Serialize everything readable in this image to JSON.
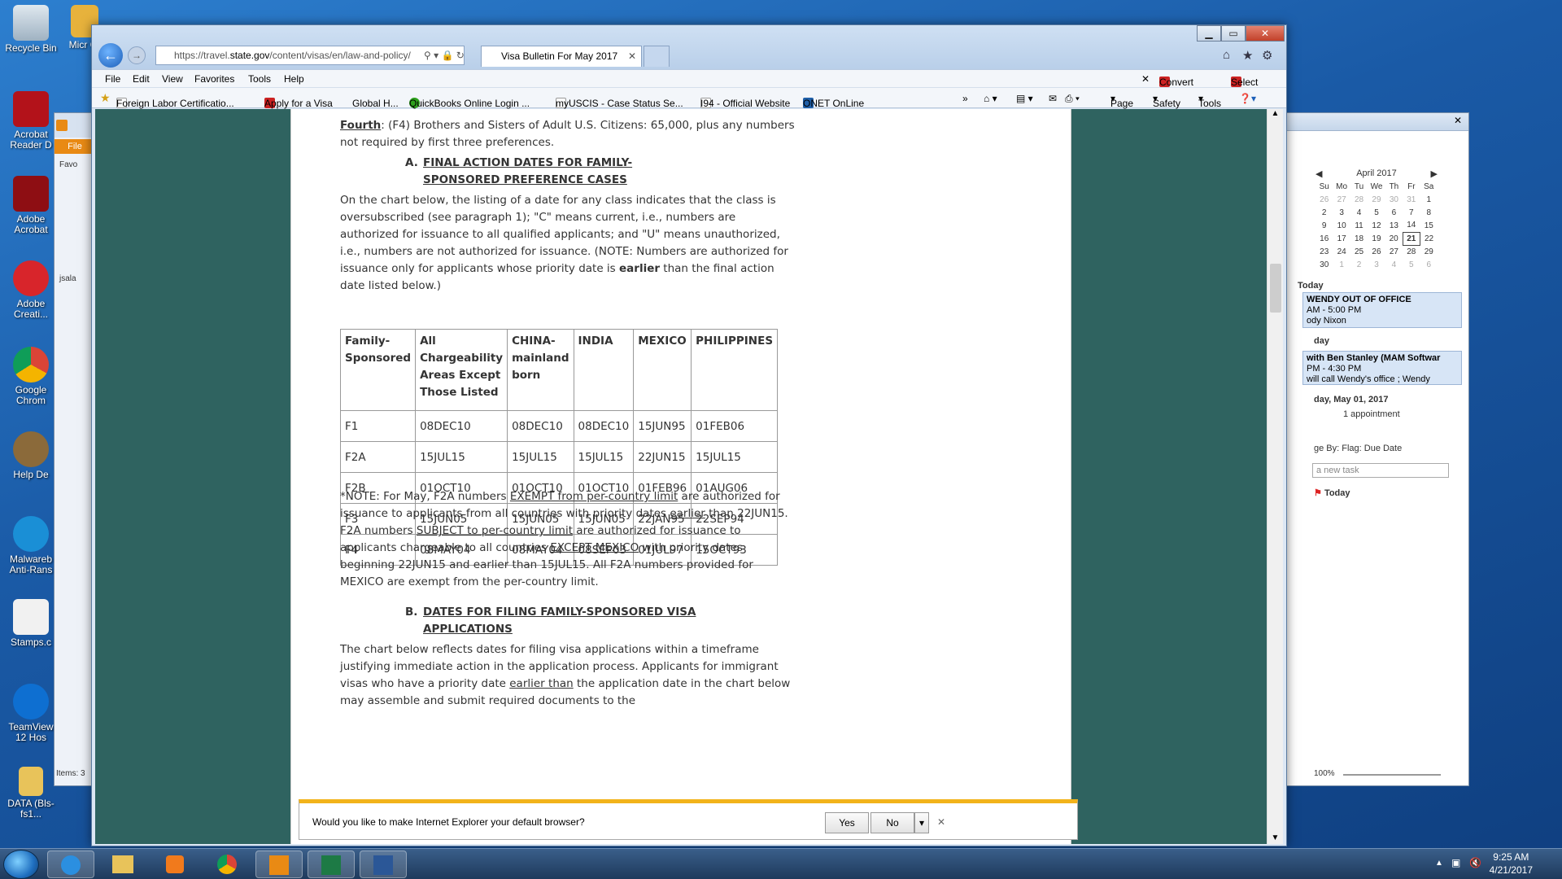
{
  "desktop": {
    "icons": [
      {
        "label": "Recycle Bin"
      },
      {
        "label": "Acrobat Reader D"
      },
      {
        "label": "Adobe Acrobat"
      },
      {
        "label": "Adobe Creati..."
      },
      {
        "label": "Google Chrom"
      },
      {
        "label": "Help De"
      },
      {
        "label": "Malwareb Anti-Rans"
      },
      {
        "label": "Stamps.c"
      },
      {
        "label": "TeamView 12 Hos"
      },
      {
        "label": "DATA (Bls-fs1..."
      }
    ],
    "partial_icon": "Micr Of"
  },
  "outlook": {
    "file_label": "File",
    "fav_label": "Favo",
    "user_label": "jsala",
    "items_label": "Items: 3",
    "calendar": {
      "month": "April 2017",
      "days": [
        "Su",
        "Mo",
        "Tu",
        "We",
        "Th",
        "Fr",
        "Sa"
      ],
      "weeks": [
        [
          "26",
          "27",
          "28",
          "29",
          "30",
          "31",
          "1"
        ],
        [
          "2",
          "3",
          "4",
          "5",
          "6",
          "7",
          "8"
        ],
        [
          "9",
          "10",
          "11",
          "12",
          "13",
          "14",
          "15"
        ],
        [
          "16",
          "17",
          "18",
          "19",
          "20",
          "21",
          "22"
        ],
        [
          "23",
          "24",
          "25",
          "26",
          "27",
          "28",
          "29"
        ],
        [
          "30",
          "1",
          "2",
          "3",
          "4",
          "5",
          "6"
        ]
      ],
      "today": "21"
    },
    "today_label": "Today",
    "appt1": {
      "title": "WENDY OUT OF OFFICE",
      "time": "AM - 5:00 PM",
      "who": "ody Nixon"
    },
    "day_label": "day",
    "appt2": {
      "title": "with Ben Stanley (MAM Softwar",
      "time": "PM - 4:30 PM",
      "note": "will call Wendy's office ; Wendy"
    },
    "may_label": "day, May 01, 2017",
    "may_count": "1 appointment",
    "arrange": "ge By: Flag: Due Date",
    "new_task": "a new task",
    "task_today": "Today",
    "zoom": "100%"
  },
  "ie": {
    "url_prefix": "https://travel.",
    "url_domain": "state.gov",
    "url_rest": "/content/visas/en/law-and-policy/",
    "tab_title": "Visa Bulletin For May 2017",
    "menu": [
      "File",
      "Edit",
      "View",
      "Favorites",
      "Tools",
      "Help"
    ],
    "convert": "Convert",
    "select": "Select",
    "favorites": [
      "Foreign Labor Certificatio...",
      "Apply for a Visa",
      "Global H...",
      "QuickBooks Online Login ...",
      "myUSCIS - Case Status Se...",
      "I94 - Official Website",
      "ONET OnLine"
    ],
    "cmd": [
      "Page",
      "Safety",
      "Tools"
    ]
  },
  "doc": {
    "fourth_label": "Fourth",
    "fourth_code": "F4",
    "fourth_text": ": (F4) Brothers and Sisters of Adult U.S. Citizens:  65,000, plus any numbers not required by first three preferences.",
    "secA_letter": "A.",
    "secA_title": "FINAL ACTION DATES FOR FAMILY-SPONSORED PREFERENCE CASES",
    "para1_before": "On the chart below, the listing of a date for any class indicates that the class is oversubscribed (see paragraph 1); \"C\" means current, i.e., numbers are authorized for issuance to all qualified applicants; and \"U\" means unauthorized, i.e., numbers are not authorized for issuance. (NOTE: Numbers are authorized for issuance only for applicants whose priority date is ",
    "para1_bold": "earlier",
    "para1_after": " than the final action date listed below.)",
    "table": {
      "headers": [
        "Family-Sponsored",
        "All Chargeability Areas Except Those Listed",
        "CHINA-mainland born",
        "INDIA",
        "MEXICO",
        "PHILIPPINES"
      ],
      "rows": [
        [
          "F1",
          "08DEC10",
          "08DEC10",
          "08DEC10",
          "15JUN95",
          "01FEB06"
        ],
        [
          "F2A",
          "15JUL15",
          "15JUL15",
          "15JUL15",
          "22JUN15",
          "15JUL15"
        ],
        [
          "F2B",
          "01OCT10",
          "01OCT10",
          "01OCT10",
          "01FEB96",
          "01AUG06"
        ],
        [
          "F3",
          "15JUN05",
          "15JUN05",
          "15JUN05",
          "22JAN95",
          "22SEP94"
        ],
        [
          "F4",
          "08MAY04",
          "08MAY04",
          "08SEP03",
          "01JUL97",
          "15OCT93"
        ]
      ]
    },
    "note": {
      "t1": "*NOTE: For May, F2A numbers ",
      "u1": "EXEMPT from per-country limit",
      "t2": " are authorized for issuance to applicants from all countries with priority dates ",
      "u2": "earlier",
      "t3": " than 22JUN15. F2A numbers ",
      "u3": "SUBJECT to per-country limit",
      "t4": " are authorized for issuance to applicants chargeable to all countries ",
      "u4": "EXCEPT MEXICO",
      "t5": " with priority dates beginning 22JUN15 and earlier than 15JUL15. All F2A numbers provided for MEXICO are exempt from the per-country limit."
    },
    "secB_letter": "B.",
    "secB_title": "DATES FOR FILING FAMILY-SPONSORED VISA APPLICATIONS",
    "para2_t1": "The chart below reflects dates for filing visa applications within a timeframe justifying immediate action in the application process. Applicants for immigrant visas who have a priority date ",
    "para2_u": "earlier than",
    "para2_t2": " the application date in the chart below may assemble and submit required documents to the"
  },
  "notify": {
    "message": "Would you like to make Internet Explorer your default browser?",
    "yes": "Yes",
    "no": "No"
  },
  "clock": {
    "time": "9:25 AM",
    "date": "4/21/2017"
  }
}
